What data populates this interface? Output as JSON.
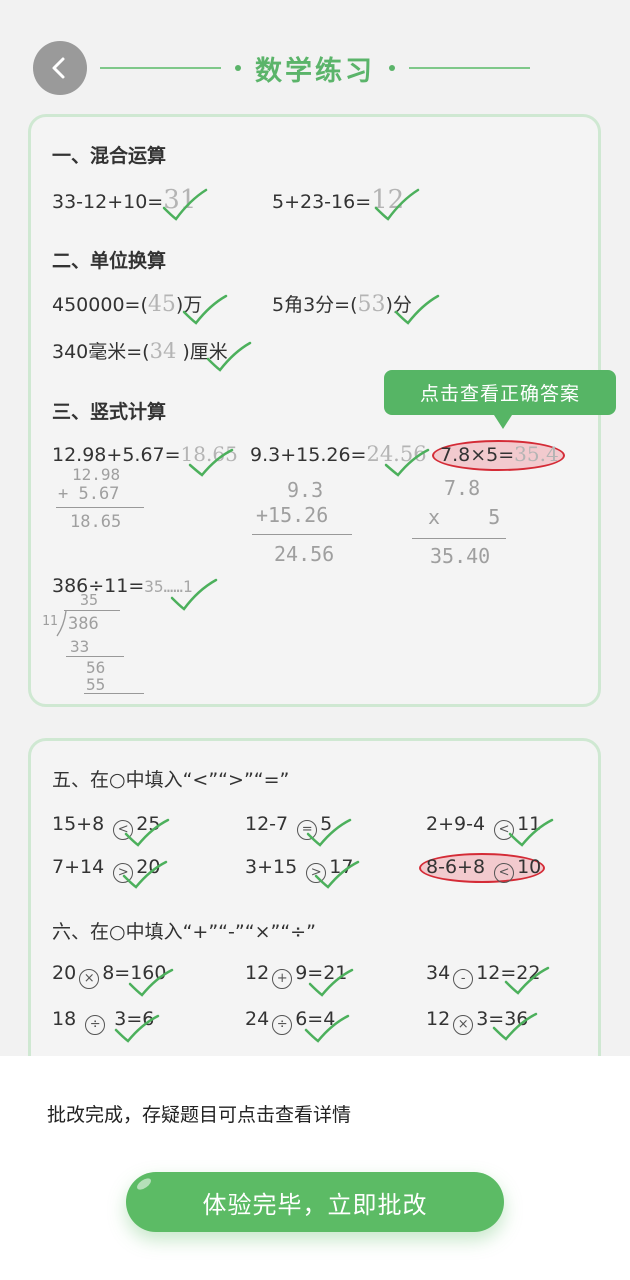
{
  "header": {
    "title": "数学练习",
    "back_icon": "chevron-left-icon"
  },
  "sections": {
    "s1": {
      "title": "一、混合运算",
      "p1": {
        "q": "33-12+10=",
        "a": "31"
      },
      "p2": {
        "q": "5+23-16=",
        "a": "12"
      }
    },
    "s2": {
      "title": "二、单位换算",
      "p1": {
        "q": "450000=(",
        "a": "45",
        "unit": ")万"
      },
      "p2": {
        "q": "5角3分=(",
        "a": "53",
        "unit": ")分"
      },
      "p3": {
        "q": "340毫米=(",
        "a": "34",
        "unit": " )厘米"
      }
    },
    "s3": {
      "title": "三、竖式计算",
      "p1": {
        "q": "12.98+5.67=",
        "a": "18.65",
        "w1": "12.98",
        "w2": "+ 5.67",
        "w3": "18.65"
      },
      "p2": {
        "q": "9.3+15.26=",
        "a": "24.56",
        "w1": "9.3",
        "w2": "+15.26",
        "w3": "24.56"
      },
      "p3": {
        "q": "7.8×5=",
        "a": "35.4",
        "w1": "7.8",
        "w2": "x    5",
        "w3": "35.40"
      },
      "p4": {
        "q": "386÷11=",
        "a": "35……1",
        "w1": "35",
        "w2": "386",
        "w3": "33",
        "w4": "56",
        "w5": "55",
        "w6": "11"
      }
    },
    "s5": {
      "title": "五、在○中填入“<”“>”“=”",
      "rows": [
        [
          {
            "l": "15+8",
            "op": "<",
            "r": "25"
          },
          {
            "l": "12-7",
            "op": "=",
            "r": "5"
          },
          {
            "l": "2+9-4",
            "op": "<",
            "r": "11"
          }
        ],
        [
          {
            "l": "7+14",
            "op": ">",
            "r": "20"
          },
          {
            "l": "3+15",
            "op": ">",
            "r": "17"
          },
          {
            "l": "8-6+8",
            "op": "<",
            "r": "10"
          }
        ]
      ]
    },
    "s6": {
      "title": "六、在○中填入“+”“-”“×”“÷”",
      "rows": [
        [
          {
            "l": "20",
            "op": "×",
            "r": "8=160"
          },
          {
            "l": "12",
            "op": "+",
            "r": "9=21"
          },
          {
            "l": "34",
            "op": "-",
            "r": "12=22"
          }
        ],
        [
          {
            "l": "18",
            "op": "÷",
            "r": "3=6"
          },
          {
            "l": "24",
            "op": "÷",
            "r": "6=4"
          },
          {
            "l": "12",
            "op": "×",
            "r": "3=36"
          }
        ]
      ]
    }
  },
  "tooltip": {
    "text": "点击查看正确答案"
  },
  "footer": {
    "status": "批改完成，存疑题目可点击查看详情",
    "button_label": "体验完毕，立即批改"
  },
  "colors": {
    "accent": "#5cbb65",
    "error": "#d42b36",
    "check": "#4cb05c"
  }
}
